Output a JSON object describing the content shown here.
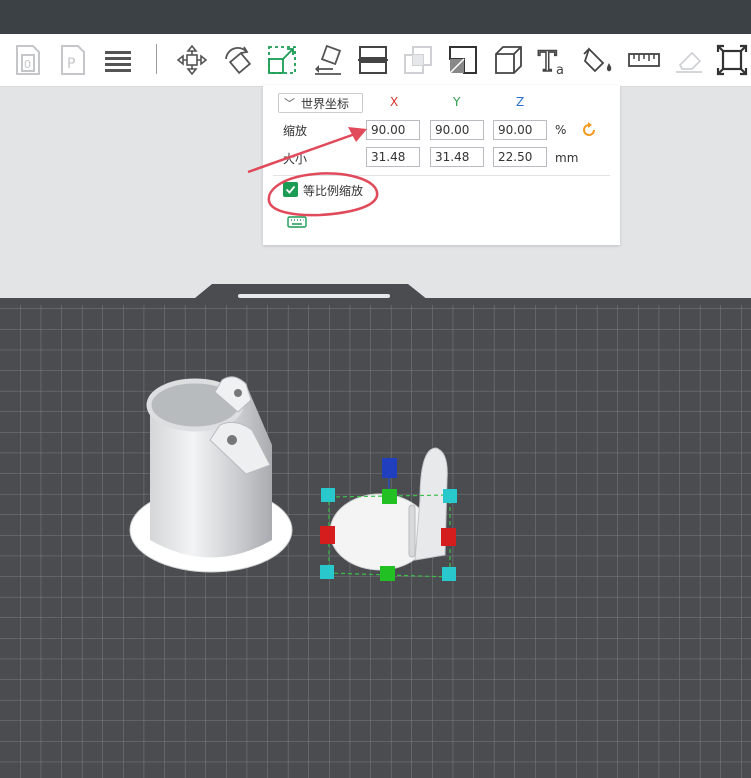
{
  "toolbar": {
    "tools": [
      {
        "icon": "new-project-icon"
      },
      {
        "icon": "open-project-icon"
      },
      {
        "icon": "list-icon"
      },
      {
        "icon": "move-icon"
      },
      {
        "icon": "rotate-icon"
      },
      {
        "icon": "scale-icon"
      },
      {
        "icon": "lay-flat-icon"
      },
      {
        "icon": "split-icon"
      },
      {
        "icon": "hollow-icon"
      },
      {
        "icon": "mirror-icon"
      },
      {
        "icon": "cube-icon"
      },
      {
        "icon": "text-icon"
      },
      {
        "icon": "paint-bucket-icon"
      },
      {
        "icon": "ruler-icon"
      },
      {
        "icon": "erase-icon"
      },
      {
        "icon": "fit-view-icon"
      }
    ]
  },
  "scale_panel": {
    "coordinate_system": "世界坐标",
    "axis_x": "X",
    "axis_y": "Y",
    "axis_z": "Z",
    "scale_label": "缩放",
    "scale_x": "90.00",
    "scale_y": "90.00",
    "scale_z": "90.00",
    "scale_unit": "%",
    "size_label": "大小",
    "size_x": "31.48",
    "size_y": "31.48",
    "size_z": "22.50",
    "size_unit": "mm",
    "uniform_scale_label": "等比例缩放",
    "uniform_scale_checked": true
  },
  "colors": {
    "accent_green": "#1a9c54",
    "axis_x": "#d9342b",
    "axis_y": "#2e9b4a",
    "axis_z": "#2d6fd0",
    "annotation": "#e04a5a",
    "reset_orange": "#f29a1e"
  }
}
